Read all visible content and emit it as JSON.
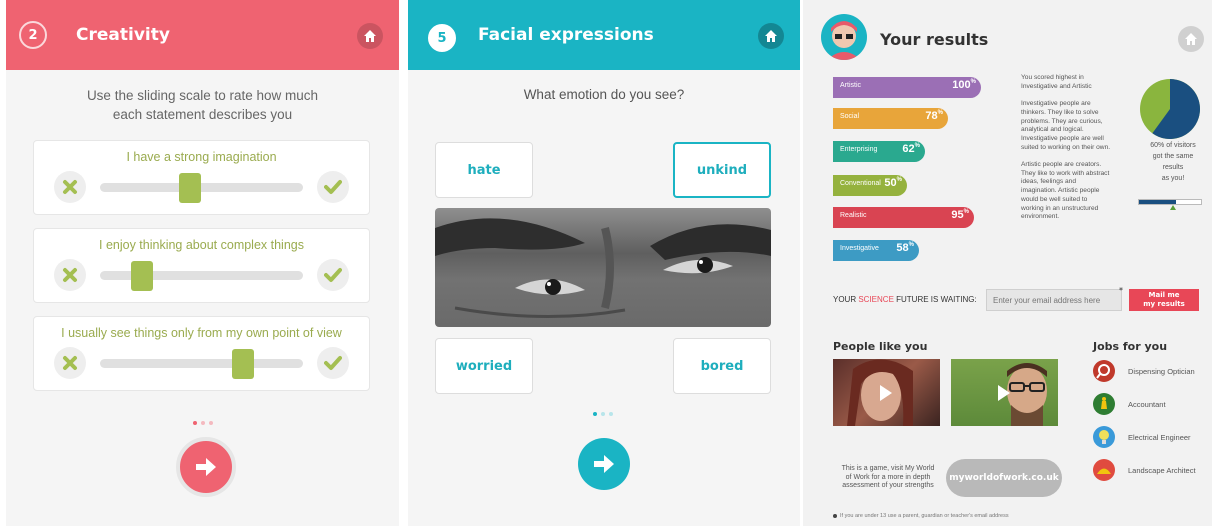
{
  "creativity": {
    "step": "2",
    "title": "Creativity",
    "instruction_line1": "Use the sliding scale to rate how much",
    "instruction_line2": "each statement describes you",
    "statements": [
      {
        "text": "I have a strong imagination",
        "level": 0.43
      },
      {
        "text": "I enjoy thinking about complex things",
        "level": 0.17
      },
      {
        "text": "I usually see things only from my own point of view",
        "level": 0.72
      }
    ],
    "page_dots": 3,
    "active_dot": 0
  },
  "facial": {
    "step": "5",
    "title": "Facial expressions",
    "question": "What emotion do you see?",
    "options": [
      "hate",
      "unkind",
      "worried",
      "bored"
    ],
    "selected_option": "unkind",
    "page_dots": 3,
    "active_dot": 0
  },
  "results": {
    "title": "Your results",
    "bars": [
      {
        "label": "Artistic",
        "value": "100",
        "color": "#9b6fb5",
        "fraction": 1.0
      },
      {
        "label": "Social",
        "value": "78",
        "color": "#e8a53a",
        "fraction": 0.78
      },
      {
        "label": "Enterprising",
        "value": "62",
        "color": "#2aa98f",
        "fraction": 0.62
      },
      {
        "label": "Conventional",
        "value": "50",
        "color": "#95b23e",
        "fraction": 0.5
      },
      {
        "label": "Realistic",
        "value": "95",
        "color": "#d94452",
        "fraction": 0.95
      },
      {
        "label": "Investigative",
        "value": "58",
        "color": "#3d9bc4",
        "fraction": 0.58
      }
    ],
    "percent_sign": "%",
    "summary_lines": [
      "You scored highest in",
      "Investigative and Artistic",
      "",
      "Investigative people are",
      "thinkers. They like to solve",
      "problems. They are curious,",
      "analytical and logical.",
      "Investigative people are well",
      "suited to working on their own.",
      "",
      "Artistic people are creators.",
      "They like to work with abstract",
      "ideas, feelings and",
      "imagination. Artistic people",
      "would be well suited to",
      "working in an unstructured",
      "environment."
    ],
    "visitors_line1": "60% of visitors",
    "visitors_line2": "got the same",
    "visitors_line3": "results",
    "visitors_line4": "as you!",
    "visitors_fraction": 0.6,
    "future_part1": "YOUR ",
    "future_part2": "SCIENCE",
    "future_part3": " FUTURE IS WAITING:",
    "email_placeholder": "Enter your email address here",
    "mail_button_line1": "Mail me",
    "mail_button_line2": "my results",
    "people_heading": "People like you",
    "jobs_heading": "Jobs for you",
    "jobs": [
      {
        "label": "Dispensing Optician",
        "color": "#c0392b"
      },
      {
        "label": "Accountant",
        "color": "#2e7d32"
      },
      {
        "label": "Electrical Engineer",
        "color": "#3a9ad9"
      },
      {
        "label": "Landscape Architect",
        "color": "#e04b3f"
      }
    ],
    "game_line1": "This is a game, visit My World",
    "game_line2": "of Work for a more in depth",
    "game_line3": "assessment of your strengths",
    "site_button": "myworldofwork.co.uk",
    "footnote": "If you are under 13 use a parent, guardian or teacher's email address"
  },
  "colors": {
    "creativity_header": "#ef6371",
    "facial_header": "#1ab4c4",
    "results_bg": "#f2f2f2",
    "mail_button": "#e84757"
  }
}
